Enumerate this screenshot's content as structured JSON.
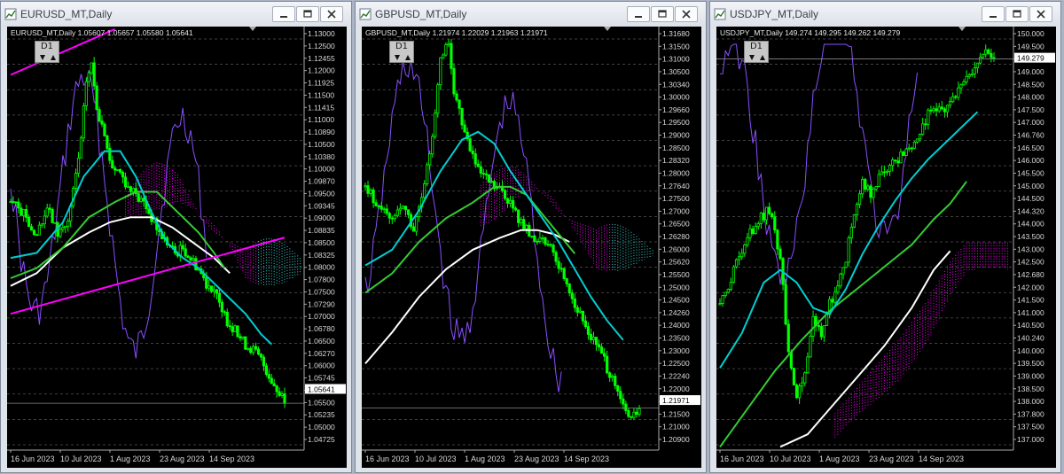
{
  "windows": [
    {
      "id": "eurusd",
      "title": "EURUSD_MT,Daily",
      "info": "EURUSD_MT,Daily  1.05607 1.05657 1.05580 1.05641",
      "period": "D1",
      "price_labels": [
        "1.13000",
        "1.12500",
        "1.12455",
        "1.12000",
        "1.11925",
        "1.11500",
        "1.11415",
        "1.11000",
        "1.10890",
        "1.10500",
        "1.10380",
        "1.10000",
        "1.09870",
        "1.09500",
        "1.09345",
        "1.09000",
        "1.08835",
        "1.08500",
        "1.08325",
        "1.08000",
        "1.07800",
        "1.07500",
        "1.07290",
        "1.07000",
        "1.06780",
        "1.06500",
        "1.06270",
        "1.06000",
        "1.05745",
        "1.05641",
        "1.05500",
        "1.05235",
        "1.05000",
        "1.04725"
      ],
      "current_price": "1.05641",
      "date_labels": [
        "16 Jun 2023",
        "10 Jul 2023",
        "1 Aug 2023",
        "23 Aug 2023",
        "14 Sep 2023"
      ]
    },
    {
      "id": "gbpusd",
      "title": "GBPUSD_MT,Daily",
      "info": "GBPUSD_MT,Daily  1.21974 1.22029 1.21963 1.21971",
      "period": "D1",
      "price_labels": [
        "1.31680",
        "1.31500",
        "1.31000",
        "1.30500",
        "1.30340",
        "1.30000",
        "1.29660",
        "1.29500",
        "1.29000",
        "1.28500",
        "1.28320",
        "1.28000",
        "1.27640",
        "1.27500",
        "1.27000",
        "1.26500",
        "1.26280",
        "1.26000",
        "1.25620",
        "1.25500",
        "1.25000",
        "1.24500",
        "1.24260",
        "1.24000",
        "1.23500",
        "1.23000",
        "1.22500",
        "1.22240",
        "1.22000",
        "1.21971",
        "1.21500",
        "1.21000",
        "1.20900"
      ],
      "current_price": "1.21971",
      "date_labels": [
        "16 Jun 2023",
        "10 Jul 2023",
        "1 Aug 2023",
        "23 Aug 2023",
        "14 Sep 2023"
      ]
    },
    {
      "id": "usdjpy",
      "title": "USDJPY_MT,Daily",
      "info": "USDJPY_MT,Daily  149.274 149.295 149.262 149.279",
      "period": "D1",
      "price_labels": [
        "150.000",
        "149.500",
        "149.279",
        "149.000",
        "148.500",
        "148.000",
        "147.500",
        "147.000",
        "146.760",
        "146.500",
        "146.000",
        "145.500",
        "145.000",
        "144.500",
        "144.320",
        "144.000",
        "143.500",
        "143.000",
        "142.500",
        "142.680",
        "142.000",
        "141.500",
        "141.000",
        "140.500",
        "140.240",
        "140.000",
        "139.500",
        "139.000",
        "138.500",
        "138.000",
        "137.800",
        "137.500",
        "137.000"
      ],
      "current_price": "149.279",
      "date_labels": [
        "16 Jun 2023",
        "10 Jul 2023",
        "1 Aug 2023",
        "23 Aug 2023",
        "14 Sep 2023"
      ]
    }
  ],
  "colors": {
    "candles": "#00ff00",
    "ma_fast": "#00ced1",
    "ma_mid": "#32cd32",
    "ma_slow": "#ffffff",
    "osc": "#8a4fff",
    "cloud_a": "#ff00ff",
    "cloud_b": "#40d0d0",
    "trend": "#ff00ff",
    "grid": "#555555",
    "background": "#000000"
  },
  "chart_data": [
    {
      "type": "candlestick",
      "symbol": "EURUSD_MT",
      "timeframe": "Daily",
      "ylim": [
        1.0472,
        1.1305
      ],
      "x_ticks": [
        "16 Jun 2023",
        "10 Jul 2023",
        "1 Aug 2023",
        "23 Aug 2023",
        "14 Sep 2023"
      ],
      "close_path": [
        [
          0,
          1.096
        ],
        [
          6,
          1.093
        ],
        [
          10,
          1.089
        ],
        [
          14,
          1.095
        ],
        [
          18,
          1.09
        ],
        [
          22,
          1.092
        ],
        [
          24,
          1.098
        ],
        [
          27,
          1.108
        ],
        [
          29,
          1.12
        ],
        [
          31,
          1.123
        ],
        [
          33,
          1.115
        ],
        [
          36,
          1.108
        ],
        [
          39,
          1.103
        ],
        [
          42,
          1.102
        ],
        [
          45,
          1.099
        ],
        [
          48,
          1.097
        ],
        [
          51,
          1.096
        ],
        [
          54,
          1.093
        ],
        [
          57,
          1.09
        ],
        [
          60,
          1.088
        ],
        [
          63,
          1.086
        ],
        [
          66,
          1.087
        ],
        [
          69,
          1.085
        ],
        [
          72,
          1.083
        ],
        [
          75,
          1.08
        ],
        [
          78,
          1.079
        ],
        [
          81,
          1.074
        ],
        [
          84,
          1.072
        ],
        [
          87,
          1.07
        ],
        [
          90,
          1.068
        ],
        [
          93,
          1.067
        ],
        [
          96,
          1.065
        ],
        [
          99,
          1.062
        ],
        [
          102,
          1.059
        ],
        [
          105,
          1.0564
        ]
      ],
      "ma_fast": [
        [
          0,
          1.085
        ],
        [
          10,
          1.086
        ],
        [
          20,
          1.092
        ],
        [
          28,
          1.101
        ],
        [
          36,
          1.106
        ],
        [
          42,
          1.106
        ],
        [
          48,
          1.101
        ],
        [
          54,
          1.094
        ],
        [
          60,
          1.088
        ],
        [
          66,
          1.085
        ],
        [
          72,
          1.083
        ],
        [
          78,
          1.08
        ],
        [
          84,
          1.077
        ],
        [
          90,
          1.074
        ],
        [
          96,
          1.07
        ],
        [
          100,
          1.068
        ]
      ],
      "ma_mid": [
        [
          0,
          1.081
        ],
        [
          10,
          1.083
        ],
        [
          20,
          1.087
        ],
        [
          30,
          1.093
        ],
        [
          40,
          1.096
        ],
        [
          48,
          1.098
        ],
        [
          56,
          1.098
        ],
        [
          64,
          1.094
        ],
        [
          72,
          1.09
        ],
        [
          78,
          1.086
        ],
        [
          82,
          1.083
        ]
      ],
      "ma_slow": [
        [
          0,
          1.0795
        ],
        [
          10,
          1.082
        ],
        [
          20,
          1.087
        ],
        [
          30,
          1.09
        ],
        [
          38,
          1.092
        ],
        [
          46,
          1.093
        ],
        [
          54,
          1.093
        ],
        [
          62,
          1.091
        ],
        [
          70,
          1.088
        ],
        [
          78,
          1.085
        ],
        [
          84,
          1.082
        ]
      ],
      "trend_lines": [
        [
          [
            0,
            1.121
          ],
          [
            40,
            1.13
          ]
        ],
        [
          [
            0,
            1.074
          ],
          [
            105,
            1.089
          ]
        ]
      ]
    },
    {
      "type": "candlestick",
      "symbol": "GBPUSD_MT",
      "timeframe": "Daily",
      "ylim": [
        1.209,
        1.3168
      ],
      "x_ticks": [
        "16 Jun 2023",
        "10 Jul 2023",
        "1 Aug 2023",
        "23 Aug 2023",
        "14 Sep 2023"
      ],
      "close_path": [
        [
          0,
          1.276
        ],
        [
          6,
          1.27
        ],
        [
          10,
          1.268
        ],
        [
          14,
          1.272
        ],
        [
          18,
          1.265
        ],
        [
          22,
          1.276
        ],
        [
          25,
          1.29
        ],
        [
          28,
          1.308
        ],
        [
          31,
          1.313
        ],
        [
          33,
          1.3
        ],
        [
          36,
          1.292
        ],
        [
          39,
          1.286
        ],
        [
          42,
          1.28
        ],
        [
          45,
          1.278
        ],
        [
          48,
          1.276
        ],
        [
          51,
          1.275
        ],
        [
          54,
          1.272
        ],
        [
          57,
          1.268
        ],
        [
          60,
          1.265
        ],
        [
          63,
          1.262
        ],
        [
          66,
          1.264
        ],
        [
          69,
          1.26
        ],
        [
          72,
          1.256
        ],
        [
          75,
          1.252
        ],
        [
          78,
          1.246
        ],
        [
          81,
          1.242
        ],
        [
          84,
          1.238
        ],
        [
          87,
          1.235
        ],
        [
          90,
          1.23
        ],
        [
          93,
          1.225
        ],
        [
          96,
          1.22
        ],
        [
          99,
          1.217
        ],
        [
          102,
          1.2197
        ]
      ],
      "ma_fast": [
        [
          0,
          1.256
        ],
        [
          10,
          1.26
        ],
        [
          20,
          1.27
        ],
        [
          28,
          1.28
        ],
        [
          36,
          1.288
        ],
        [
          42,
          1.29
        ],
        [
          48,
          1.287
        ],
        [
          54,
          1.28
        ],
        [
          60,
          1.274
        ],
        [
          66,
          1.268
        ],
        [
          72,
          1.262
        ],
        [
          78,
          1.255
        ],
        [
          84,
          1.248
        ],
        [
          90,
          1.242
        ],
        [
          96,
          1.237
        ]
      ],
      "ma_mid": [
        [
          0,
          1.249
        ],
        [
          10,
          1.254
        ],
        [
          20,
          1.262
        ],
        [
          30,
          1.268
        ],
        [
          40,
          1.272
        ],
        [
          48,
          1.276
        ],
        [
          54,
          1.276
        ],
        [
          60,
          1.274
        ],
        [
          66,
          1.269
        ],
        [
          72,
          1.264
        ],
        [
          78,
          1.259
        ]
      ],
      "ma_slow": [
        [
          0,
          1.231
        ],
        [
          10,
          1.239
        ],
        [
          20,
          1.248
        ],
        [
          30,
          1.255
        ],
        [
          40,
          1.26
        ],
        [
          50,
          1.263
        ],
        [
          58,
          1.265
        ],
        [
          64,
          1.265
        ],
        [
          70,
          1.264
        ],
        [
          76,
          1.262
        ]
      ]
    },
    {
      "type": "candlestick",
      "symbol": "USDJPY_MT",
      "timeframe": "Daily",
      "ylim": [
        136.9,
        150.3
      ],
      "x_ticks": [
        "16 Jun 2023",
        "10 Jul 2023",
        "1 Aug 2023",
        "23 Aug 2023",
        "14 Sep 2023"
      ],
      "close_path": [
        [
          0,
          141.5
        ],
        [
          6,
          142.8
        ],
        [
          10,
          143.6
        ],
        [
          14,
          144.2
        ],
        [
          18,
          144.5
        ],
        [
          22,
          143.0
        ],
        [
          25,
          140.0
        ],
        [
          28,
          138.5
        ],
        [
          31,
          139.5
        ],
        [
          34,
          141.0
        ],
        [
          37,
          140.5
        ],
        [
          40,
          141.5
        ],
        [
          43,
          142.0
        ],
        [
          46,
          143.0
        ],
        [
          49,
          144.5
        ],
        [
          52,
          145.3
        ],
        [
          55,
          145.0
        ],
        [
          58,
          145.5
        ],
        [
          61,
          145.8
        ],
        [
          64,
          146.0
        ],
        [
          67,
          146.3
        ],
        [
          70,
          146.5
        ],
        [
          73,
          147.0
        ],
        [
          76,
          147.5
        ],
        [
          79,
          147.8
        ],
        [
          82,
          147.6
        ],
        [
          85,
          148.0
        ],
        [
          88,
          148.3
        ],
        [
          91,
          148.8
        ],
        [
          94,
          149.2
        ],
        [
          97,
          149.4
        ],
        [
          100,
          149.28
        ]
      ],
      "ma_fast": [
        [
          0,
          139.5
        ],
        [
          8,
          140.6
        ],
        [
          16,
          142.2
        ],
        [
          22,
          142.6
        ],
        [
          28,
          142.2
        ],
        [
          34,
          141.4
        ],
        [
          40,
          141.2
        ],
        [
          46,
          142.0
        ],
        [
          52,
          143.1
        ],
        [
          58,
          144.0
        ],
        [
          64,
          144.8
        ],
        [
          70,
          145.5
        ],
        [
          76,
          146.1
        ],
        [
          82,
          146.6
        ],
        [
          88,
          147.1
        ],
        [
          94,
          147.6
        ]
      ],
      "ma_mid": [
        [
          0,
          137.0
        ],
        [
          10,
          138.2
        ],
        [
          20,
          139.4
        ],
        [
          30,
          140.4
        ],
        [
          40,
          141.3
        ],
        [
          50,
          142.0
        ],
        [
          60,
          142.7
        ],
        [
          70,
          143.4
        ],
        [
          78,
          144.2
        ],
        [
          84,
          144.7
        ],
        [
          90,
          145.4
        ]
      ],
      "ma_slow": [
        [
          22,
          137.0
        ],
        [
          32,
          137.4
        ],
        [
          40,
          138.2
        ],
        [
          50,
          139.2
        ],
        [
          60,
          140.2
        ],
        [
          70,
          141.4
        ],
        [
          78,
          142.6
        ],
        [
          84,
          143.2
        ]
      ]
    }
  ]
}
